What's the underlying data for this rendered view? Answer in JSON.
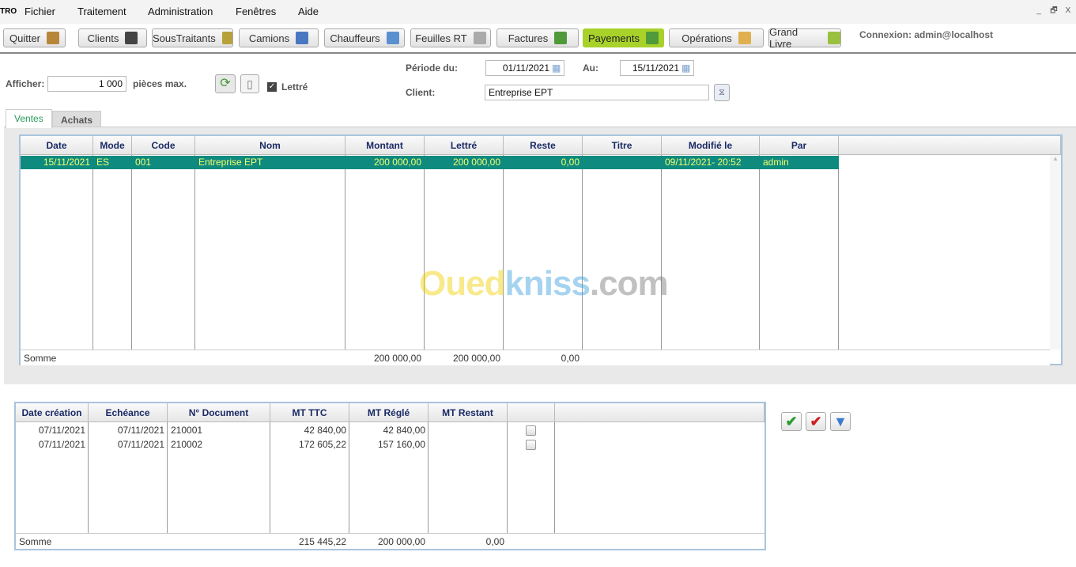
{
  "app": {
    "logo": "TRO"
  },
  "menu": [
    "Fichier",
    "Traitement",
    "Administration",
    "Fenêtres",
    "Aide"
  ],
  "window_controls": [
    "_",
    "🗗",
    "X"
  ],
  "toolbar": [
    {
      "label": "Quitter",
      "icon": "door-exit-icon",
      "color": "#b8863b"
    },
    {
      "label": "Clients",
      "icon": "user-icon",
      "color": "#444"
    },
    {
      "label": "SousTraitants",
      "icon": "users-icon",
      "color": "#b7a13a"
    },
    {
      "label": "Camions",
      "icon": "truck-icon",
      "color": "#4a78c0"
    },
    {
      "label": "Chauffeurs",
      "icon": "driver-card-icon",
      "color": "#5a8fd0"
    },
    {
      "label": "Feuilles RT",
      "icon": "sheet-clock-icon",
      "color": "#aaa"
    },
    {
      "label": "Factures",
      "icon": "invoice-icon",
      "color": "#4f9a3a"
    },
    {
      "label": "Payements",
      "icon": "payment-icon",
      "color": "#4f9a3a",
      "active": true
    },
    {
      "label": "Opérations",
      "icon": "folder-icon",
      "color": "#e0b050"
    },
    {
      "label": "Grand Livre",
      "icon": "book-icon",
      "color": "#9ac040"
    }
  ],
  "connexion": "Connexion: admin@localhost",
  "filters": {
    "afficher_label": "Afficher:",
    "afficher_value": "1 000",
    "pieces_label": "pièces max.",
    "lettre_label": "Lettré",
    "lettre_checked": true,
    "periode_label": "Période du:",
    "periode_du": "01/11/2021",
    "au_label": "Au:",
    "au": "15/11/2021",
    "client_label": "Client:",
    "client": "Entreprise EPT"
  },
  "tabs": [
    {
      "label": "Ventes",
      "active": true
    },
    {
      "label": "Achats"
    }
  ],
  "ventes": {
    "columns": [
      "Date",
      "Mode",
      "Code",
      "Nom",
      "Montant",
      "Lettré",
      "Reste",
      "Titre",
      "Modifié le",
      "Par"
    ],
    "rows": [
      [
        "15/11/2021",
        "ES",
        "001",
        "Entreprise EPT",
        "200 000,00",
        "200 000,00",
        "0,00",
        "",
        "09/11/2021- 20:52",
        "admin"
      ]
    ],
    "footer": {
      "label": "Somme",
      "montant": "200 000,00",
      "lettre": "200 000,00",
      "reste": "0,00"
    }
  },
  "documents": {
    "columns": [
      "Date création",
      "Echéance",
      "N° Document",
      "MT TTC",
      "MT Réglé",
      "MT Restant",
      ""
    ],
    "rows": [
      [
        "07/11/2021",
        "07/11/2021",
        "210001",
        "42 840,00",
        "42 840,00",
        ""
      ],
      [
        "07/11/2021",
        "07/11/2021",
        "210002",
        "172 605,22",
        "157 160,00",
        ""
      ]
    ],
    "footer": {
      "label": "Somme",
      "ttc": "215 445,22",
      "regle": "200 000,00",
      "restant": "0,00"
    }
  },
  "actions": [
    {
      "icon": "check-green-icon",
      "color": "#2a9a2a"
    },
    {
      "icon": "check-red-icon",
      "color": "#cc2020"
    },
    {
      "icon": "arrow-down-icon",
      "color": "#3a7ad0"
    }
  ],
  "watermark": "Ouedkniss.com"
}
